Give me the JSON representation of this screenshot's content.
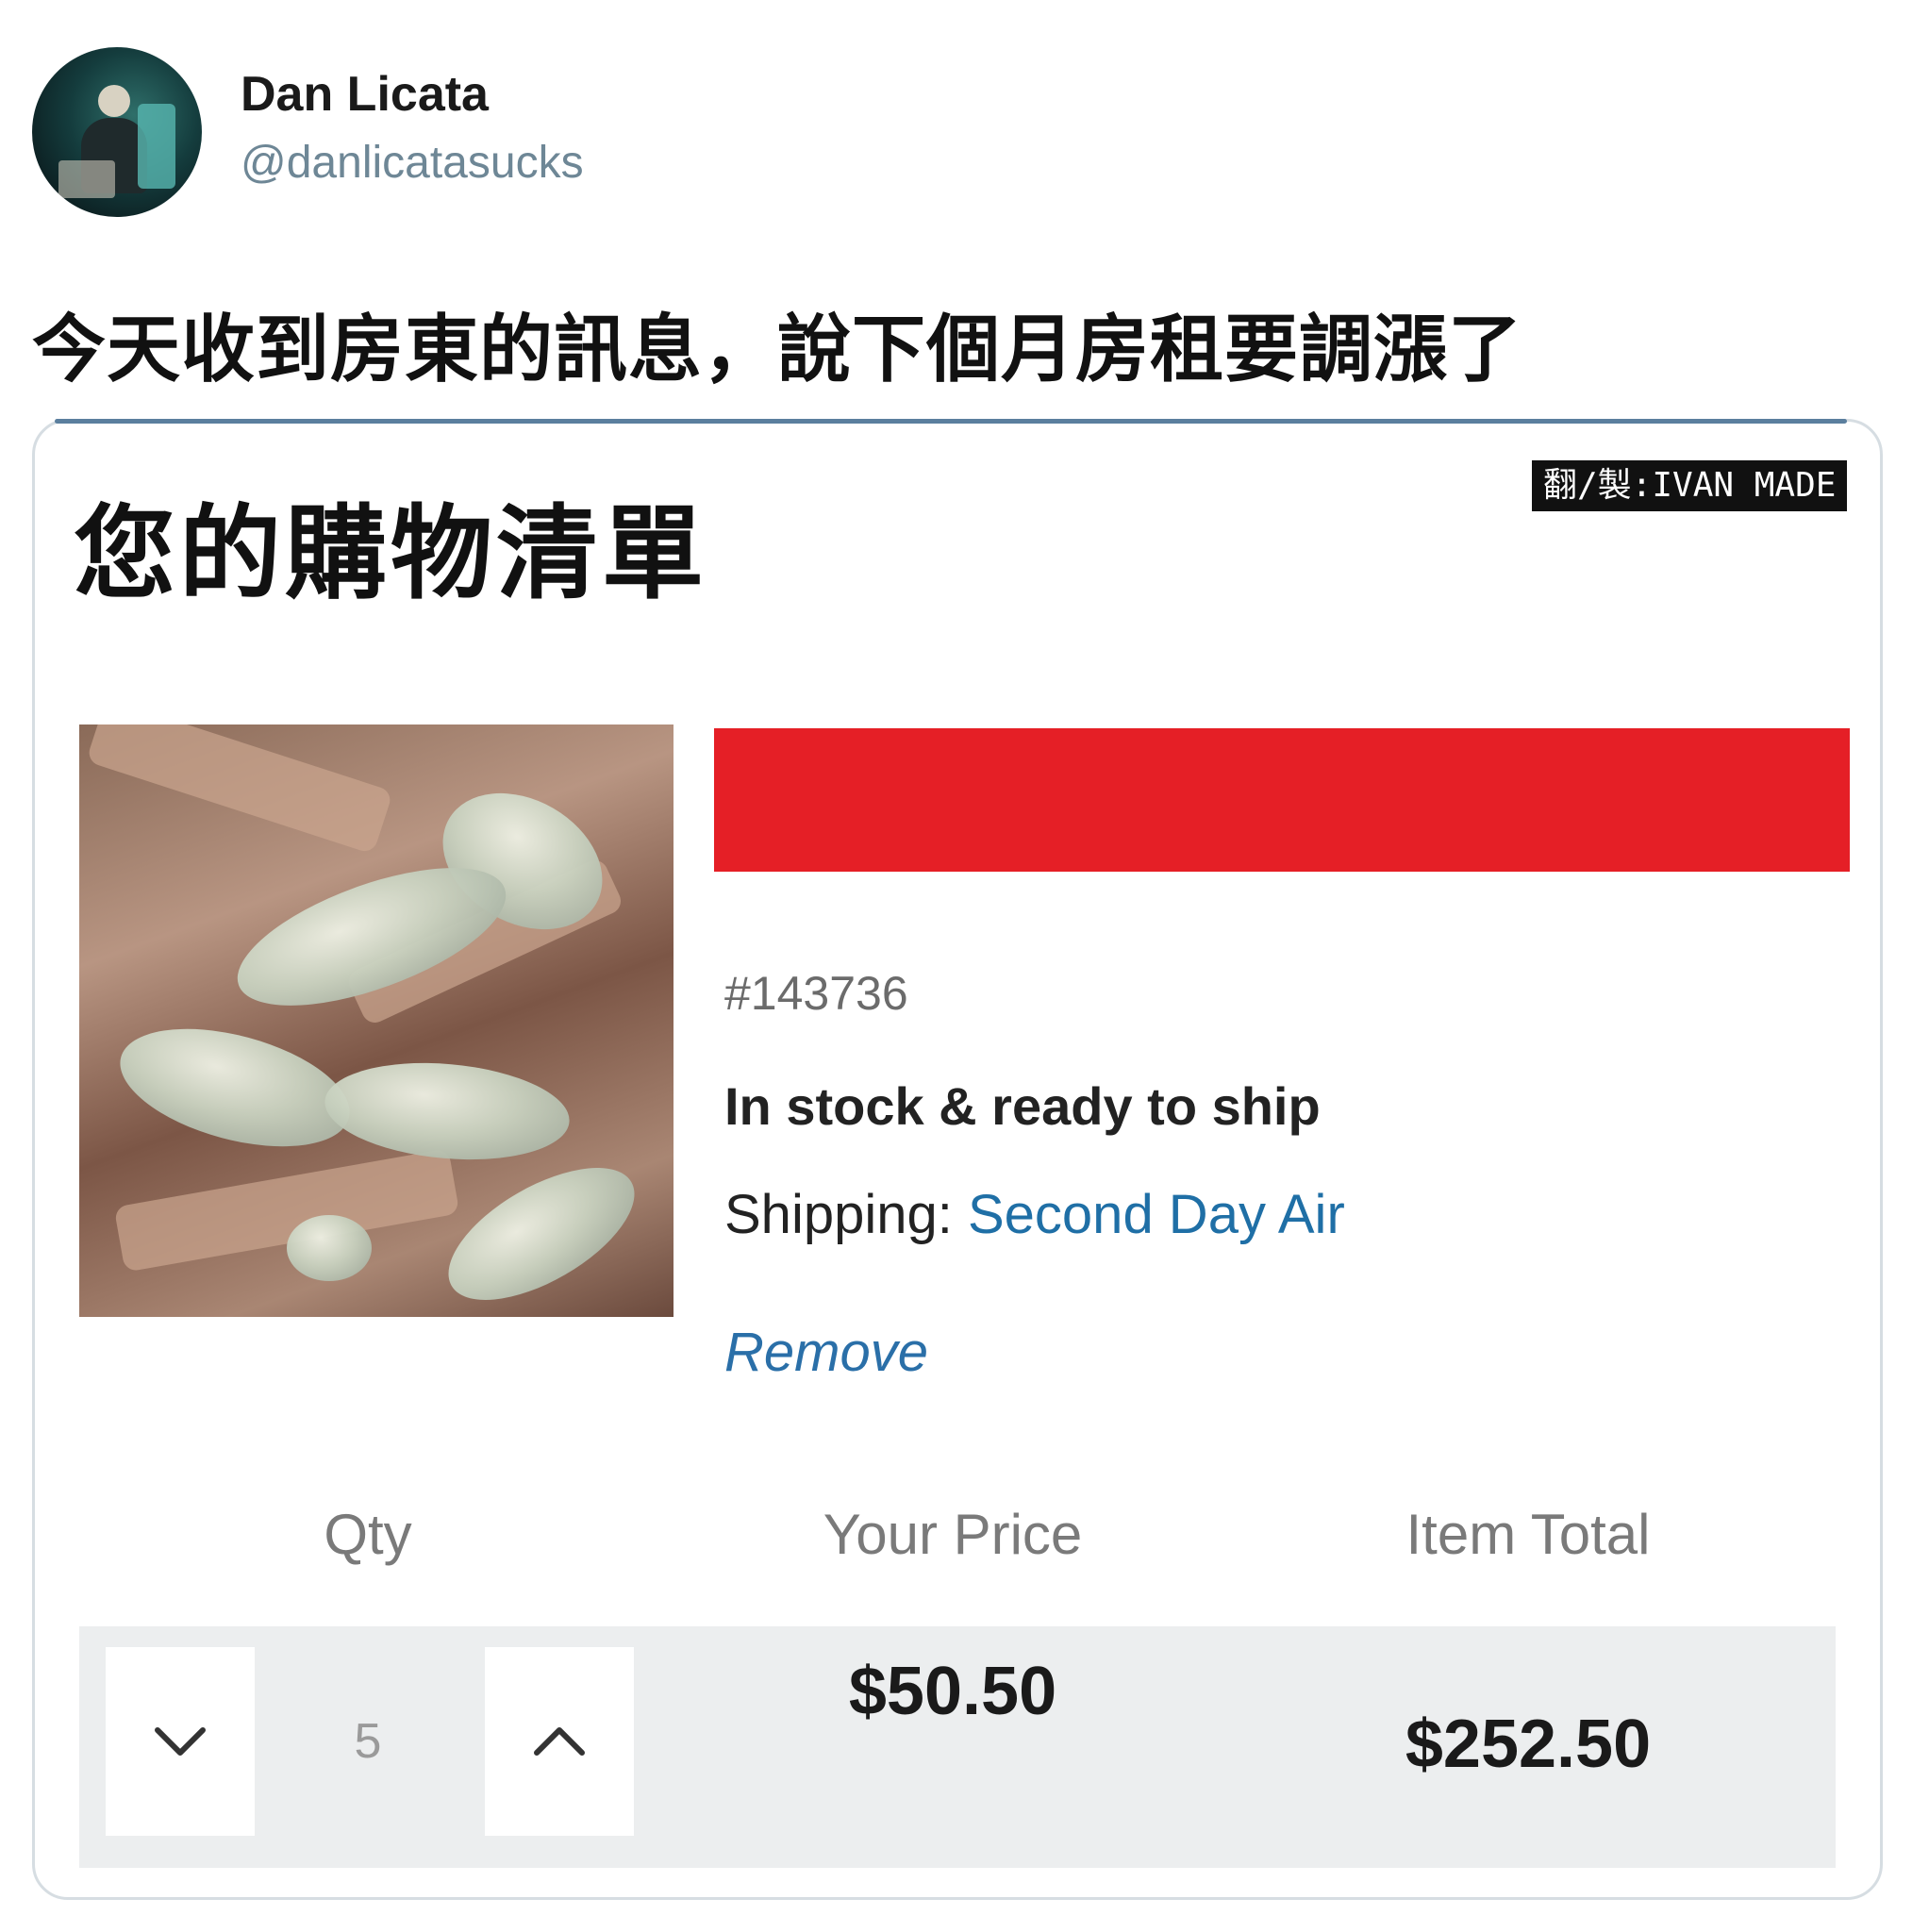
{
  "tweet": {
    "author_name": "Dan Licata",
    "author_handle": "@danlicatasucks",
    "text": "今天收到房東的訊息，說下個月房租要調漲了"
  },
  "cart": {
    "title": "您的購物清單",
    "credit": "翻/製:IVAN MADE",
    "item": {
      "sku": "#143736",
      "stock_status": "In stock & ready to ship",
      "shipping_label": "Shipping:",
      "shipping_method": "Second Day Air",
      "remove_label": "Remove"
    },
    "columns": {
      "qty": "Qty",
      "price": "Your Price",
      "total": "Item Total"
    },
    "quantity": "5",
    "price": "$50.50",
    "item_total": "$252.50"
  },
  "icons": {
    "decrease": "chevron-down-icon",
    "increase": "chevron-up-icon"
  },
  "colors": {
    "redaction": "#e51f26",
    "link": "#1f6fa6",
    "handle": "#6e8796",
    "qty_row_bg": "#eceeef"
  }
}
